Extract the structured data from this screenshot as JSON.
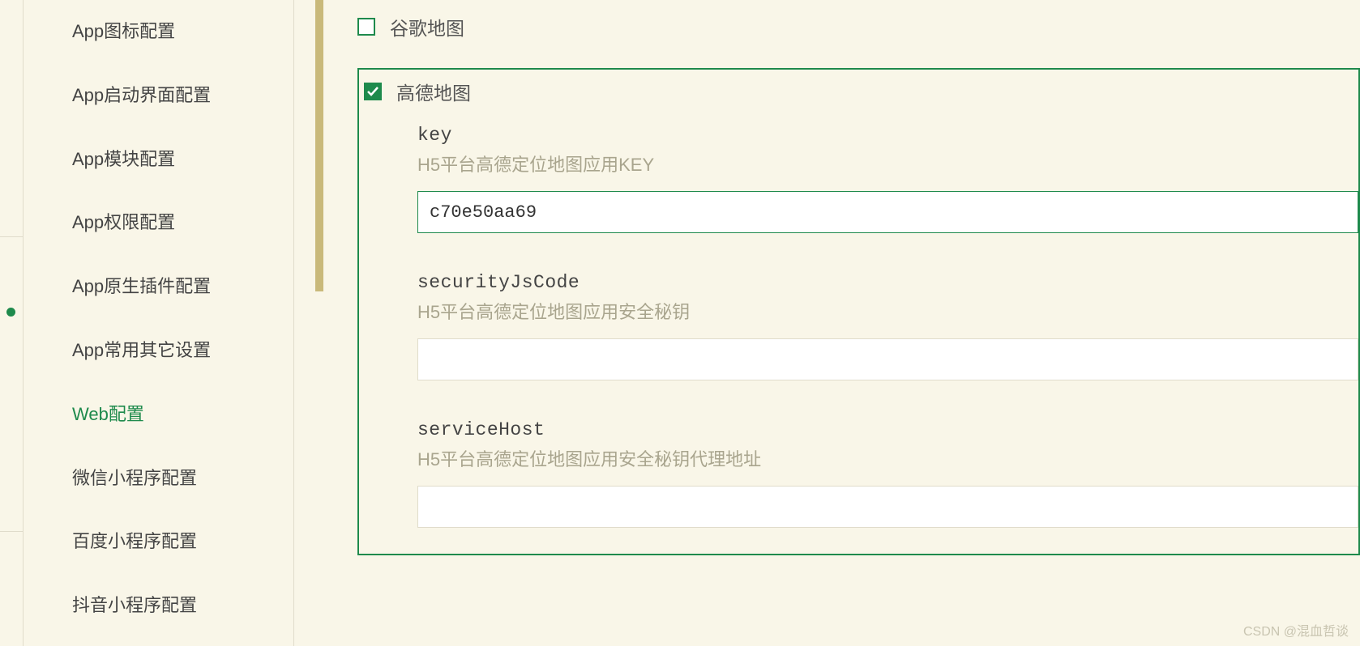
{
  "sidebar": {
    "items": [
      {
        "label": "App图标配置"
      },
      {
        "label": "App启动界面配置"
      },
      {
        "label": "App模块配置"
      },
      {
        "label": "App权限配置"
      },
      {
        "label": "App原生插件配置"
      },
      {
        "label": "App常用其它设置"
      },
      {
        "label": "Web配置",
        "active": true
      },
      {
        "label": "微信小程序配置"
      },
      {
        "label": "百度小程序配置"
      },
      {
        "label": "抖音小程序配置"
      }
    ]
  },
  "main": {
    "google": {
      "label": "谷歌地图",
      "checked": false
    },
    "amap": {
      "label": "高德地图",
      "checked": true,
      "fields": {
        "key": {
          "label": "key",
          "desc": "H5平台高德定位地图应用KEY",
          "value": "c70e50aa69"
        },
        "securityJsCode": {
          "label": "securityJsCode",
          "desc": "H5平台高德定位地图应用安全秘钥",
          "value": ""
        },
        "serviceHost": {
          "label": "serviceHost",
          "desc": "H5平台高德定位地图应用安全秘钥代理地址",
          "value": ""
        }
      }
    }
  },
  "watermark": "CSDN @混血哲谈"
}
